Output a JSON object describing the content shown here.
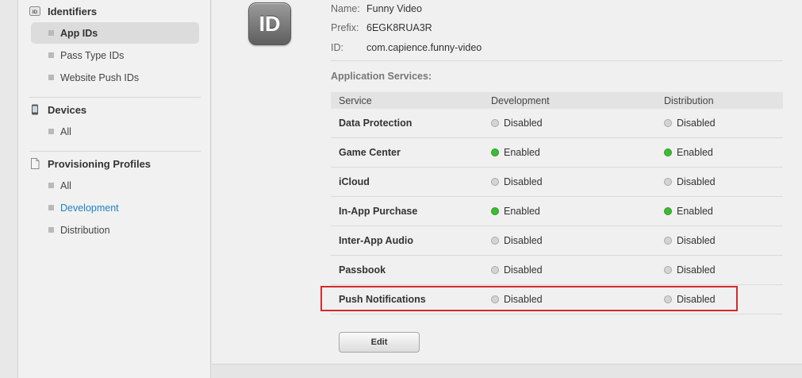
{
  "sidebar": {
    "identifiers": {
      "title": "Identifiers",
      "icon": "id-badge-icon",
      "items": [
        {
          "label": "App IDs"
        },
        {
          "label": "Pass Type IDs"
        },
        {
          "label": "Website Push IDs"
        }
      ]
    },
    "devices": {
      "title": "Devices",
      "icon": "iphone-icon",
      "items": [
        {
          "label": "All"
        }
      ]
    },
    "profiles": {
      "title": "Provisioning Profiles",
      "icon": "document-icon",
      "items": [
        {
          "label": "All"
        },
        {
          "label": "Development"
        },
        {
          "label": "Distribution"
        }
      ]
    }
  },
  "app": {
    "icon_text": "ID",
    "name_label": "Name:",
    "name": "Funny Video",
    "prefix_label": "Prefix:",
    "prefix": "6EGK8RUA3R",
    "id_label": "ID:",
    "id": "com.capience.funny-video"
  },
  "services": {
    "title": "Application Services:",
    "headers": [
      "Service",
      "Development",
      "Distribution"
    ],
    "rows": [
      {
        "name": "Data Protection",
        "dev": "Disabled",
        "dist": "Disabled"
      },
      {
        "name": "Game Center",
        "dev": "Enabled",
        "dist": "Enabled"
      },
      {
        "name": "iCloud",
        "dev": "Disabled",
        "dist": "Disabled"
      },
      {
        "name": "In-App Purchase",
        "dev": "Enabled",
        "dist": "Enabled"
      },
      {
        "name": "Inter-App Audio",
        "dev": "Disabled",
        "dist": "Disabled"
      },
      {
        "name": "Passbook",
        "dev": "Disabled",
        "dist": "Disabled"
      },
      {
        "name": "Push Notifications",
        "dev": "Disabled",
        "dist": "Disabled"
      }
    ]
  },
  "edit_label": "Edit",
  "colors": {
    "enabled": "#3dbb32",
    "disabled": "#d4d4d4",
    "highlight": "#d42b2b",
    "link": "#1a82c4"
  }
}
